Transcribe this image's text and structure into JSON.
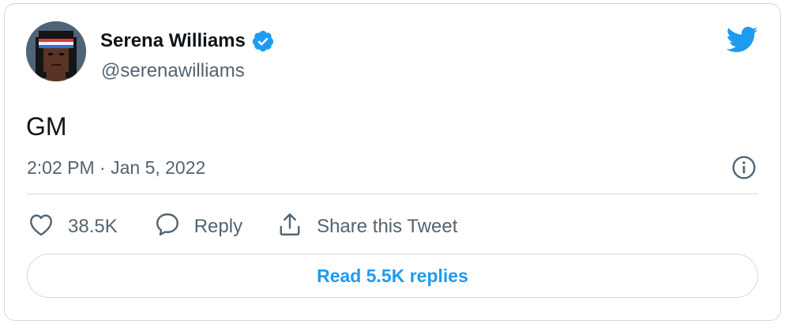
{
  "author": {
    "name": "Serena Williams",
    "handle": "@serenawilliams",
    "verified": true
  },
  "tweet": {
    "text": "GM",
    "timestamp": "2:02 PM · Jan 5, 2022"
  },
  "actions": {
    "like_count": "38.5K",
    "reply_label": "Reply",
    "share_label": "Share this Tweet"
  },
  "read_replies_label": "Read 5.5K replies",
  "icons": {
    "brand": "twitter-bird-icon",
    "verified": "verified-badge-icon",
    "info": "info-icon",
    "like": "heart-icon",
    "reply": "speech-bubble-icon",
    "share": "share-upload-icon"
  },
  "colors": {
    "brand_blue": "#1d9bf0",
    "text_primary": "#0f1419",
    "text_secondary": "#536471",
    "border": "#cfd9de"
  }
}
